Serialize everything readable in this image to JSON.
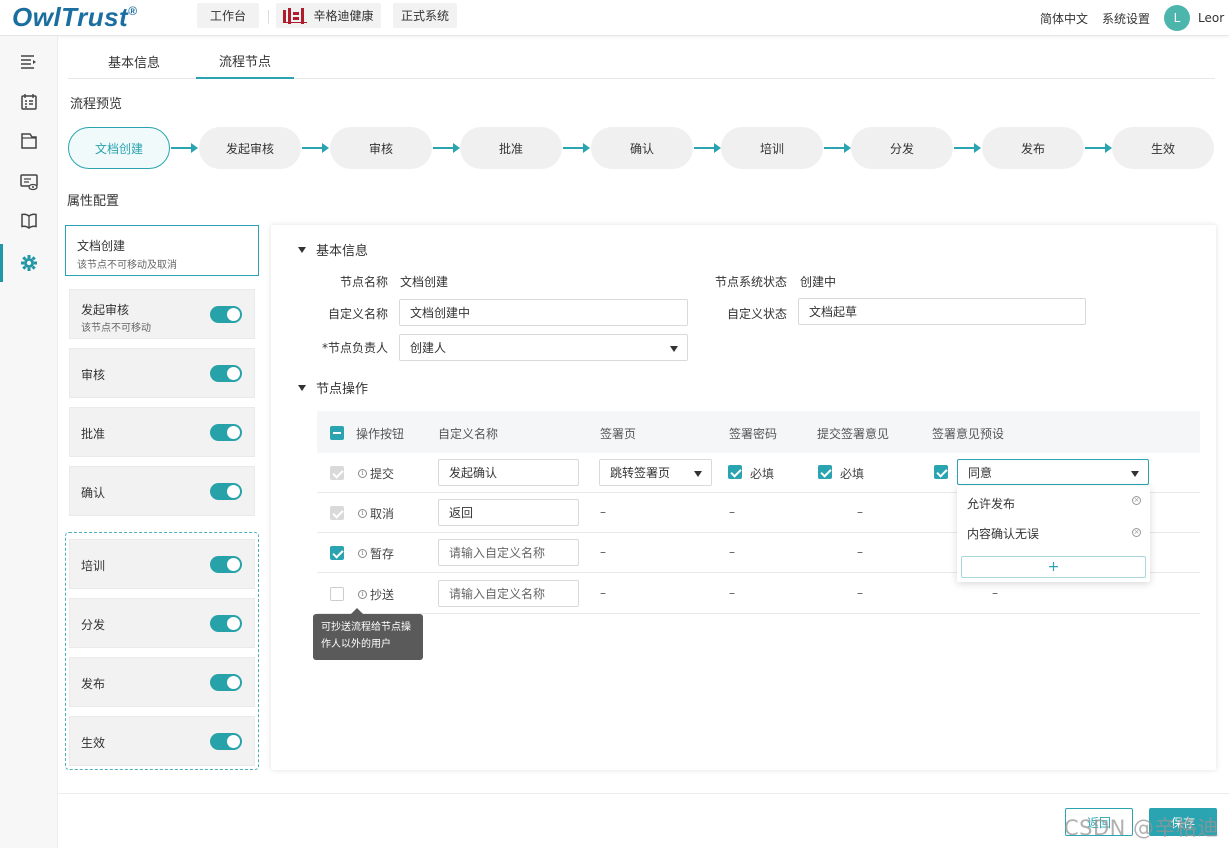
{
  "header": {
    "logo": "OwlTrust",
    "logo_mark": "®",
    "workbench": "工作台",
    "company": "辛格迪健康",
    "system": "正式系统",
    "language": "简体中文",
    "settings": "系统设置",
    "avatar_initial": "L",
    "username": "Leor"
  },
  "sidebar": {
    "icons": [
      "menu-collapse-icon",
      "calendar-icon",
      "folder-icon",
      "monitor-eye-icon",
      "book-icon",
      "gear-icon"
    ],
    "active_index": 5
  },
  "tabs": [
    "基本信息",
    "流程节点"
  ],
  "active_tab": "流程节点",
  "flow_preview": {
    "title": "流程预览",
    "nodes": [
      "文档创建",
      "发起审核",
      "审核",
      "批准",
      "确认",
      "培训",
      "分发",
      "发布",
      "生效"
    ]
  },
  "attr_config": {
    "title": "属性配置",
    "nodes": [
      {
        "title": "文档创建",
        "sub": "该节点不可移动及取消"
      },
      {
        "title": "发起审核",
        "sub": "该节点不可移动",
        "enabled": true
      },
      {
        "title": "审核",
        "enabled": true
      },
      {
        "title": "批准",
        "enabled": true
      },
      {
        "title": "确认",
        "enabled": true
      },
      {
        "title": "培训",
        "enabled": true
      },
      {
        "title": "分发",
        "enabled": true
      },
      {
        "title": "发布",
        "enabled": true
      },
      {
        "title": "生效",
        "enabled": true
      }
    ]
  },
  "basic_info": {
    "title": "基本信息",
    "node_name_label": "节点名称",
    "node_name": "文档创建",
    "sys_status_label": "节点系统状态",
    "sys_status": "创建中",
    "custom_name_label": "自定义名称",
    "custom_name": "文档创建中",
    "custom_status_label": "自定义状态",
    "custom_status": "文档起草",
    "owner_label": "*节点负责人",
    "owner": "创建人"
  },
  "node_ops": {
    "title": "节点操作",
    "columns": [
      "操作按钮",
      "自定义名称",
      "签署页",
      "签署密码",
      "提交签署意见",
      "签署意见预设"
    ],
    "rows": [
      {
        "op": "提交",
        "custom": "发起确认",
        "sign_page": "跳转签署页",
        "password": "必填",
        "opinion": "必填",
        "preset": "同意"
      },
      {
        "op": "取消",
        "custom": "返回",
        "sign_page": "–",
        "password": "–",
        "opinion": "–",
        "preset": "–"
      },
      {
        "op": "暂存",
        "custom": "请输入自定义名称",
        "sign_page": "–",
        "password": "–",
        "opinion": "–",
        "preset": "–"
      },
      {
        "op": "抄送",
        "custom": "请输入自定义名称",
        "sign_page": "–",
        "password": "–",
        "opinion": "–",
        "preset": "–"
      }
    ],
    "preset_options": [
      "允许发布",
      "内容确认无误"
    ],
    "add_symbol": "+",
    "tooltip": "可抄送流程给节点操作人以外的用户"
  },
  "footer": {
    "back": "返回",
    "save": "保存",
    "watermark": "CSDN @辛格迪"
  },
  "colors": {
    "accent": "#2aa4b0",
    "logo": "#1a6fa0",
    "company_red": "#b01c2e"
  }
}
